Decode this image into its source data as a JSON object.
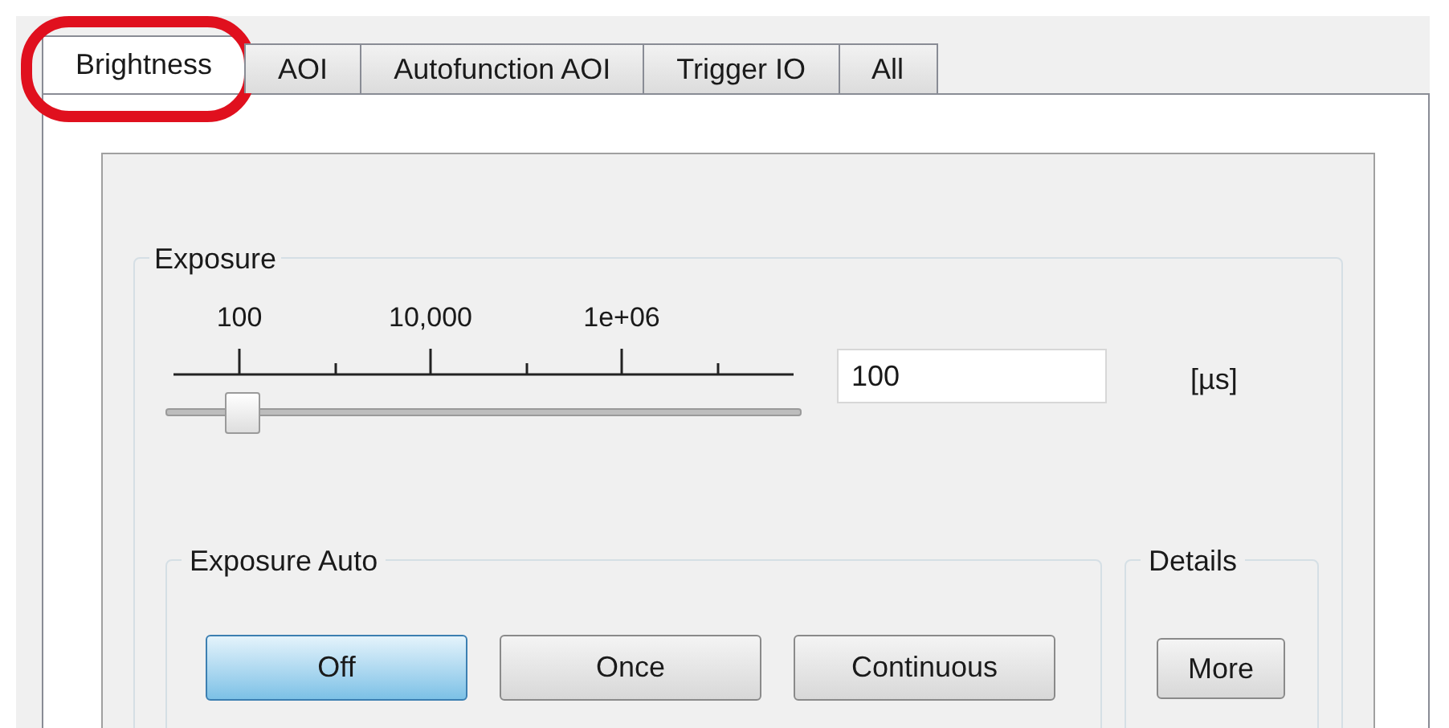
{
  "tabs": [
    {
      "label": "Brightness",
      "selected": true,
      "highlighted": true
    },
    {
      "label": "AOI",
      "selected": false,
      "highlighted": false
    },
    {
      "label": "Autofunction AOI",
      "selected": false,
      "highlighted": false
    },
    {
      "label": "Trigger IO",
      "selected": false,
      "highlighted": false
    },
    {
      "label": "All",
      "selected": false,
      "highlighted": false
    }
  ],
  "exposure": {
    "title": "Exposure",
    "scale_labels": [
      "100",
      "10,000",
      "1e+06"
    ],
    "level": 0.12,
    "value": "100",
    "unit": "[µs]"
  },
  "exposure_auto": {
    "title": "Exposure Auto",
    "options": [
      {
        "label": "Off",
        "selected": true
      },
      {
        "label": "Once",
        "selected": false
      },
      {
        "label": "Continuous",
        "selected": false
      }
    ]
  },
  "details": {
    "title": "Details",
    "button": "More"
  }
}
